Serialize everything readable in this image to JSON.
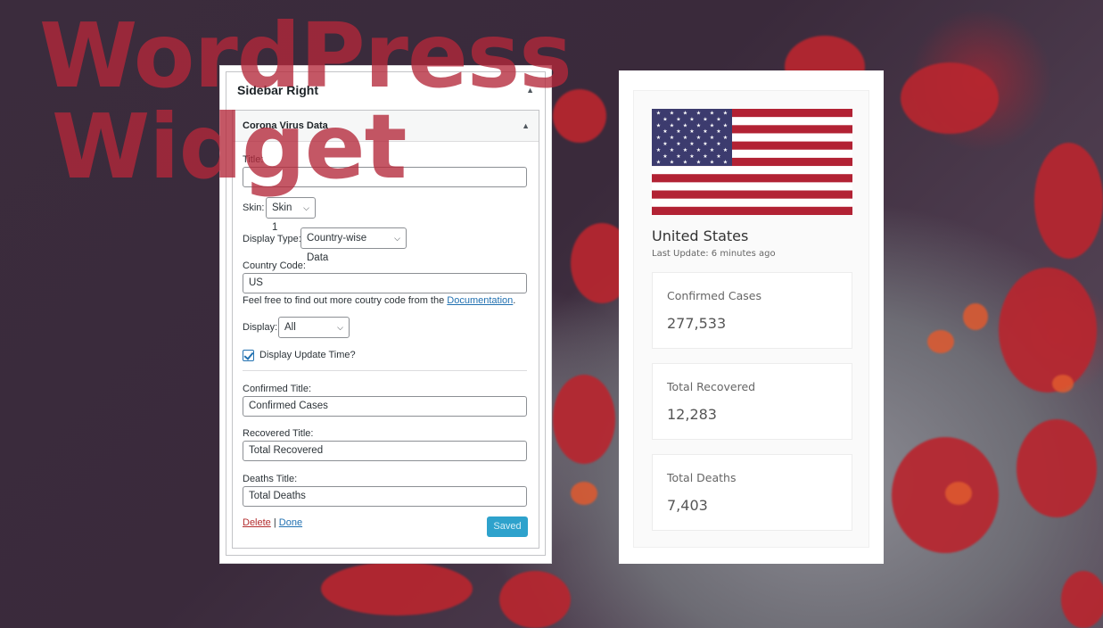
{
  "watermark": {
    "line1": "WordPress",
    "line2": "Widget"
  },
  "admin": {
    "sidebar_title": "Sidebar Right",
    "widget_title": "Corona Virus Data",
    "fields": {
      "title_label": "Title:",
      "title_value": "",
      "skin_label": "Skin:",
      "skin_value": "Skin 1",
      "display_type_label": "Display Type:",
      "display_type_value": "Country-wise Data",
      "country_code_label": "Country Code:",
      "country_code_value": "US",
      "help_text": "Feel free to find out more coutry code from the ",
      "help_link": "Documentation",
      "help_end": ".",
      "display_label": "Display:",
      "display_value": "All",
      "update_time_label": "Display Update Time?",
      "update_time_checked": true,
      "confirmed_label": "Confirmed Title:",
      "confirmed_value": "Confirmed Cases",
      "recovered_label": "Recovered Title:",
      "recovered_value": "Total Recovered",
      "deaths_label": "Deaths Title:",
      "deaths_value": "Total Deaths"
    },
    "actions": {
      "delete": "Delete",
      "separator": "|",
      "done": "Done",
      "saved": "Saved"
    }
  },
  "preview": {
    "country": "United States",
    "last_update": "Last Update: 6 minutes ago",
    "stats": [
      {
        "title": "Confirmed Cases",
        "value": "277,533"
      },
      {
        "title": "Total Recovered",
        "value": "12,283"
      },
      {
        "title": "Total Deaths",
        "value": "7,403"
      }
    ]
  },
  "colors": {
    "accent": "#2271b1",
    "saved_button": "#2ea2cc",
    "watermark": "#b4283a",
    "delete": "#b32d2e"
  },
  "icons": {
    "collapse": "triangle-up-icon",
    "dropdown": "chevron-down-icon",
    "check": "checkmark-icon",
    "flag": "us-flag"
  }
}
